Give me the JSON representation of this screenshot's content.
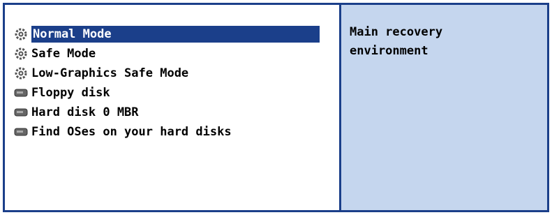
{
  "colors": {
    "frame": "#1b3f8a",
    "selection_bg": "#1b3f8a",
    "selection_fg": "#ffffff",
    "description_bg": "#c5d6ee"
  },
  "menu": {
    "selected_index": 0,
    "items": [
      {
        "label": "Normal Mode",
        "icon": "gear-icon"
      },
      {
        "label": "Safe Mode",
        "icon": "gear-icon"
      },
      {
        "label": "Low-Graphics Safe Mode",
        "icon": "gear-icon"
      },
      {
        "label": "Floppy disk",
        "icon": "drive-icon"
      },
      {
        "label": "Hard disk 0 MBR",
        "icon": "drive-icon"
      },
      {
        "label": "Find OSes on your hard disks",
        "icon": "drive-icon"
      }
    ]
  },
  "description": {
    "text": "Main recovery\nenvironment"
  }
}
